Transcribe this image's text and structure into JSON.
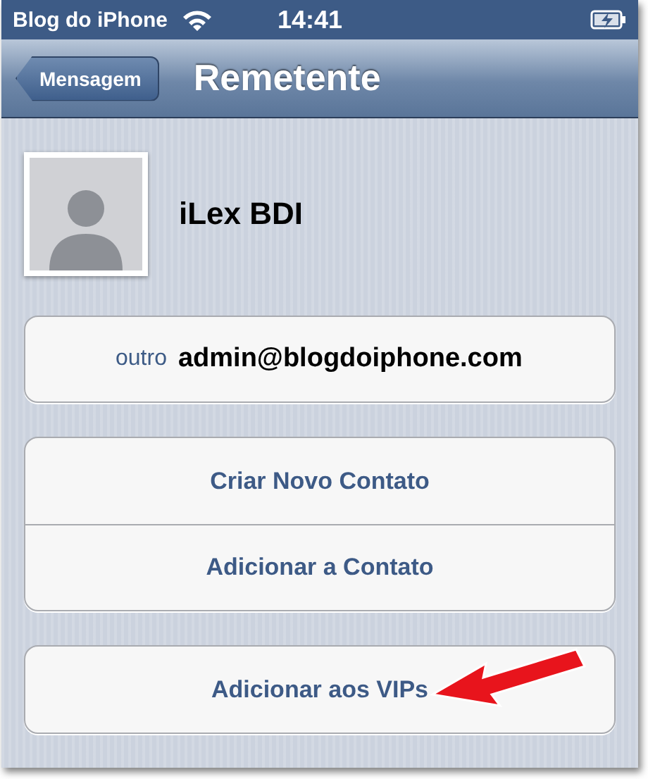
{
  "status_bar": {
    "carrier": "Blog do iPhone",
    "time": "14:41"
  },
  "nav_bar": {
    "back": "Mensagem",
    "title": "Remetente"
  },
  "contact": {
    "name": "iLex BDI"
  },
  "email": {
    "label": "outro",
    "value": "admin@blogdoiphone.com"
  },
  "actions": [
    {
      "label": "Criar Novo Contato"
    },
    {
      "label": "Adicionar a Contato"
    }
  ],
  "vip": {
    "label": "Adicionar aos VIPs"
  }
}
